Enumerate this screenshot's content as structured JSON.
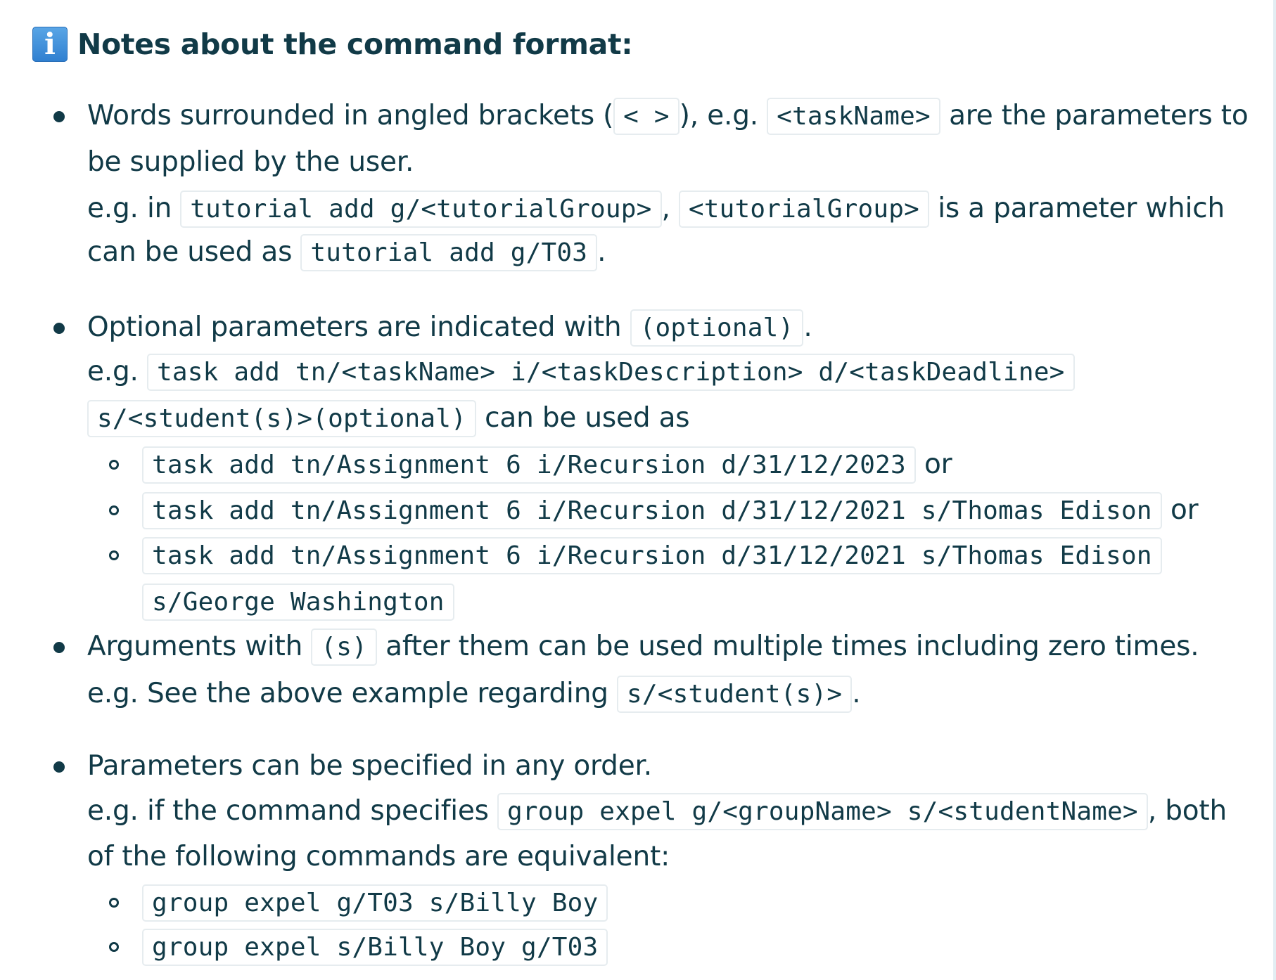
{
  "note": {
    "icon": "info-icon",
    "title": "Notes about the command format:"
  },
  "bullet1": {
    "line1": {
      "t1": "Words surrounded in angled brackets (",
      "c1": "< >",
      "t2": "), e.g. ",
      "c2": "<taskName>",
      "t3": " are the parameters to"
    },
    "line2": "be supplied by the user.",
    "line3": {
      "t1": "e.g. in ",
      "c1": "tutorial add g/<tutorialGroup>",
      "t2": ", ",
      "c2": "<tutorialGroup>",
      "t3": " is a parameter which"
    },
    "line4": {
      "t1": "can be used as ",
      "c1": "tutorial add g/T03",
      "t2": "."
    }
  },
  "bullet2": {
    "line1": {
      "t1": "Optional parameters are indicated with ",
      "c1": "(optional)",
      "t2": "."
    },
    "line2": {
      "t1": "e.g. ",
      "c1": "task add tn/<taskName> i/<taskDescription> d/<taskDeadline>"
    },
    "line3": {
      "c1": "s/<student(s)>(optional)",
      "t1": " can be used as"
    },
    "examples": [
      {
        "code": "task add tn/Assignment 6 i/Recursion d/31/12/2023",
        "suffix": " or"
      },
      {
        "code": "task add tn/Assignment 6 i/Recursion d/31/12/2021 s/Thomas Edison",
        "suffix": " or"
      },
      {
        "code": "task add tn/Assignment 6 i/Recursion d/31/12/2021 s/Thomas Edison",
        "suffix": ""
      }
    ],
    "example3_cont": "s/George Washington"
  },
  "bullet3": {
    "line1": {
      "t1": "Arguments with ",
      "c1": "(s)",
      "t2": " after them can be used multiple times including zero times."
    },
    "line2": {
      "t1": "e.g. See the above example regarding ",
      "c1": "s/<student(s)>",
      "t2": "."
    }
  },
  "bullet4": {
    "line1": "Parameters can be specified in any order.",
    "line2": {
      "t1": "e.g. if the command specifies ",
      "c1": "group expel g/<groupName> s/<studentName>",
      "t2": ", both"
    },
    "line3": "of the following commands are equivalent:",
    "examples": [
      "group expel g/T03 s/Billy Boy",
      "group expel s/Billy Boy g/T03"
    ]
  }
}
